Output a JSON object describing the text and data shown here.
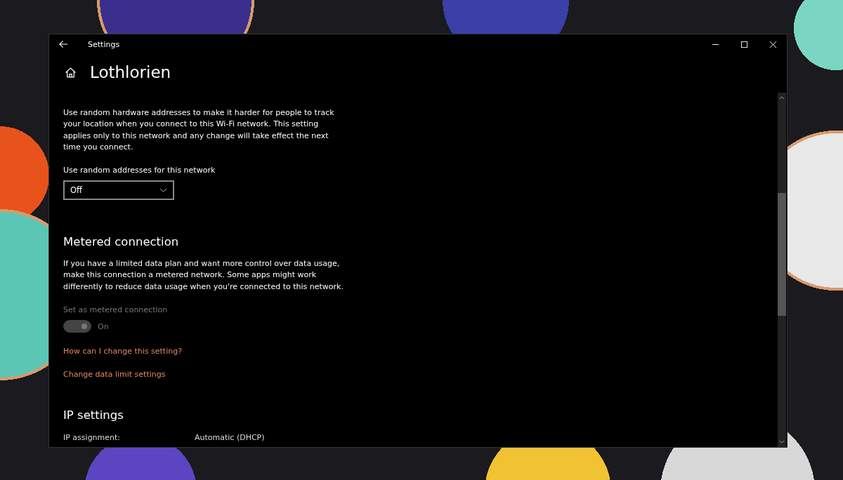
{
  "window": {
    "title": "Settings"
  },
  "page": {
    "title": "Lothlorien"
  },
  "random_hardware": {
    "description": "Use random hardware addresses to make it harder for people to track your location when you connect to this Wi-Fi network. This setting applies only to this network and any change will take effect the next time you connect.",
    "dropdown_label": "Use random addresses for this network",
    "dropdown_value": "Off"
  },
  "metered": {
    "heading": "Metered connection",
    "description": "If you have a limited data plan and want more control over data usage, make this connection a metered network. Some apps might work differently to reduce data usage when you're connected to this network.",
    "toggle_label": "Set as metered connection",
    "toggle": {
      "on": true,
      "disabled": true,
      "state_text": "On"
    },
    "links": [
      "How can I change this setting?",
      "Change data limit settings"
    ]
  },
  "ip": {
    "heading": "IP settings",
    "rows": [
      {
        "label": "IP assignment:",
        "value": "Automatic (DHCP)"
      }
    ]
  }
}
